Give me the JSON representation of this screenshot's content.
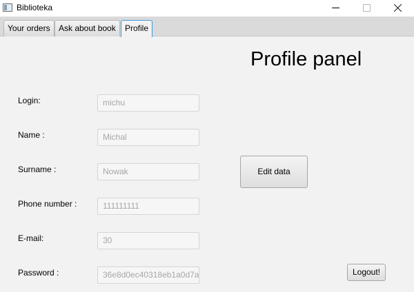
{
  "window": {
    "title": "Biblioteka",
    "icon": "app-window-icon"
  },
  "tabs": [
    {
      "label": "Your orders"
    },
    {
      "label": "Ask about book"
    },
    {
      "label": "Profile",
      "selected": true
    }
  ],
  "panel": {
    "heading": "Profile panel",
    "fields": [
      {
        "label": "Login:",
        "value": "michu"
      },
      {
        "label": "Name :",
        "value": "Michal"
      },
      {
        "label": "Surname :",
        "value": "Nowak"
      },
      {
        "label": "Phone number :",
        "value": "111111111"
      },
      {
        "label": "E-mail:",
        "value": "30"
      },
      {
        "label": "Password :",
        "value": "36e8d0ec40318eb1a0d7a"
      }
    ],
    "edit_button": "Edit data",
    "logout_button": "Logout!"
  },
  "colors": {
    "background": "#f2f2f2",
    "tab_accent": "#3b9ad8",
    "field_text": "#a6a6a6"
  }
}
